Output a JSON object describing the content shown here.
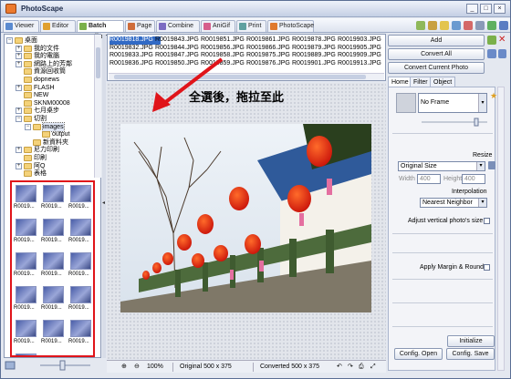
{
  "window": {
    "title": "PhotoScape",
    "min_icon": "minimize-icon",
    "max_icon": "maximize-icon",
    "close_icon": "close-icon"
  },
  "tabs": [
    {
      "label": "Viewer",
      "color": "#5a8ad0"
    },
    {
      "label": "Editor",
      "color": "#e0a030"
    },
    {
      "label": "Batch Editor",
      "color": "#7ab04a"
    },
    {
      "label": "Page",
      "color": "#cf6d3b"
    },
    {
      "label": "Combine",
      "color": "#7c6bc2"
    },
    {
      "label": "AniGif",
      "color": "#d65f8c"
    },
    {
      "label": "Print",
      "color": "#5fa0a0"
    },
    {
      "label": "PhotoScape",
      "color": "#e07a2e"
    }
  ],
  "active_tab": "Batch Editor",
  "tree": [
    {
      "label": "桌面",
      "depth": 0,
      "exp": "−"
    },
    {
      "label": "我的文件",
      "depth": 1,
      "exp": "+"
    },
    {
      "label": "我的電腦",
      "depth": 1,
      "exp": "+"
    },
    {
      "label": "網路上的芳鄰",
      "depth": 1,
      "exp": "+"
    },
    {
      "label": "資源回收筒",
      "depth": 1,
      "exp": ""
    },
    {
      "label": "dopnews",
      "depth": 1,
      "exp": ""
    },
    {
      "label": "FLASH",
      "depth": 1,
      "exp": "+"
    },
    {
      "label": "NEW",
      "depth": 1,
      "exp": ""
    },
    {
      "label": "SKNM00008",
      "depth": 1,
      "exp": ""
    },
    {
      "label": "七月桌步",
      "depth": 1,
      "exp": "+"
    },
    {
      "label": "切割",
      "depth": 1,
      "exp": "−"
    },
    {
      "label": "images",
      "depth": 2,
      "exp": "−",
      "selected": true
    },
    {
      "label": "output",
      "depth": 3,
      "exp": ""
    },
    {
      "label": "新資料夾",
      "depth": 2,
      "exp": ""
    },
    {
      "label": "尼力印刷",
      "depth": 1,
      "exp": "+"
    },
    {
      "label": "印刷",
      "depth": 1,
      "exp": ""
    },
    {
      "label": "阿Q",
      "depth": 1,
      "exp": "+"
    },
    {
      "label": "表格",
      "depth": 1,
      "exp": ""
    }
  ],
  "thumbnails": [
    "R0019...",
    "R0019...",
    "R0019...",
    "R0019...",
    "R0019...",
    "R0019...",
    "R0019...",
    "R0019...",
    "R0019...",
    "R0019...",
    "R0019...",
    "R0019...",
    "R0019...",
    "R0019...",
    "R0019...",
    "R0019..."
  ],
  "file_columns": [
    [
      "R0019818.JPG",
      "R0019832.JPG",
      "R0019833.JPG",
      "R0019836.JPG"
    ],
    [
      "R0019843.JPG",
      "R0019844.JPG",
      "R0019847.JPG",
      "R0019850.JPG"
    ],
    [
      "R0019851.JPG",
      "R0019856.JPG",
      "R0019858.JPG",
      "R0019859.JPG"
    ],
    [
      "R0019861.JPG",
      "R0019866.JPG",
      "R0019875.JPG",
      "R0019876.JPG"
    ],
    [
      "R0019878.JPG",
      "R0019879.JPG",
      "R0019889.JPG",
      "R0019901.JPG"
    ],
    [
      "R0019903.JPG",
      "R0019905.JPG",
      "R0019909.JPG",
      "R0019913.JPG"
    ]
  ],
  "selected_file": "R0019818.JPG",
  "annotation": "全選後，拖拉至此",
  "status": {
    "zoom": "100%",
    "original": "Original 500 x 375",
    "converted": "Converted 500 x 375"
  },
  "right": {
    "add_label": "Add",
    "convert_all_label": "Convert All",
    "convert_current_label": "Convert Current Photo",
    "tabs": [
      "Home",
      "Filter",
      "Object"
    ],
    "frame_value": "No Frame",
    "resize_label": "Resize",
    "resize_value": "Original Size",
    "width_label": "Width",
    "width_value": "400",
    "height_label": "Height",
    "height_value": "400",
    "interp_label": "Interpolation",
    "interp_value": "Nearest Neighbor",
    "adjust_label": "Adjust vertical photo's size",
    "margin_label": "Apply Margin & Round",
    "initialize_label": "Initialize",
    "config_open_label": "Config. Open",
    "config_save_label": "Config. Save"
  }
}
